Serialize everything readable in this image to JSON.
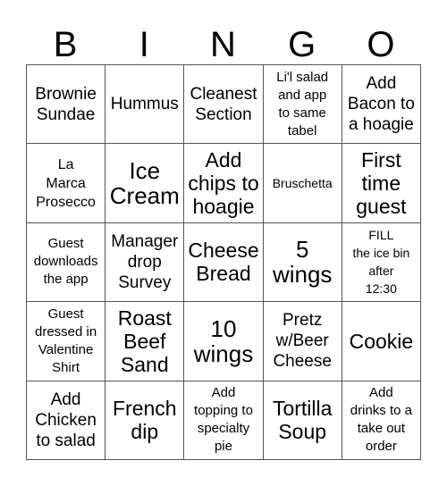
{
  "header": {
    "letters": [
      "B",
      "I",
      "N",
      "G",
      "O"
    ]
  },
  "board": {
    "rows": [
      [
        "Brownie\nSundae",
        "Hummus",
        "Cleanest\nSection",
        "Li'l salad\nand app\nto same\ntabel",
        "Add\nBacon to\na hoagie"
      ],
      [
        "La\nMarca\nProsecco",
        "Ice\nCream",
        "Add\nchips to\nhoagie",
        "Bruschetta",
        "First\ntime\nguest"
      ],
      [
        "Guest\ndownloads\nthe app",
        "Manager\ndrop\nSurvey",
        "Cheese\nBread",
        "5\nwings",
        "FILL\nthe ice bin\nafter\n12:30"
      ],
      [
        "Guest\ndressed in\nValentine\nShirt",
        "Roast\nBeef\nSand",
        "10\nwings",
        "Pretz\nw/Beer\nCheese",
        "Cookie"
      ],
      [
        "Add\nChicken\nto salad",
        "French\ndip",
        "Add\ntopping to\nspecialty\npie",
        "Tortilla\nSoup",
        "Add\ndrinks to a\ntake out\norder"
      ]
    ]
  },
  "colors": {
    "grid_line": "#555555",
    "text": "#000000",
    "background": "#ffffff"
  }
}
